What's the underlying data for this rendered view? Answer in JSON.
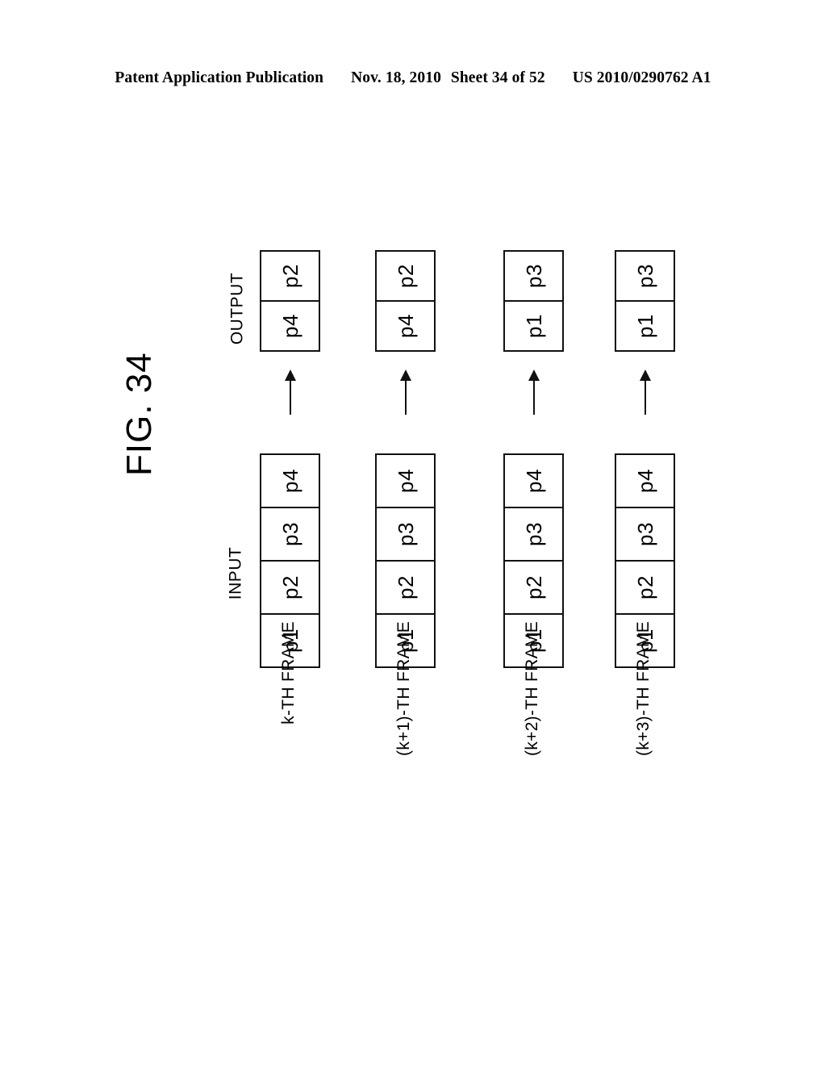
{
  "header": {
    "publication": "Patent Application Publication",
    "date": "Nov. 18, 2010",
    "sheet": "Sheet 34 of 52",
    "patent_number": "US 2010/0290762 A1"
  },
  "figure": {
    "label": "FIG. 34",
    "input_caption": "INPUT",
    "output_caption": "OUTPUT",
    "arrow_icon": "up-arrow-icon",
    "orientation": "rotated-90-ccw",
    "line_color": "#111111",
    "background_color": "#ffffff",
    "rows": [
      {
        "frame_label": "k-TH FRAME",
        "input_cells": [
          "p1",
          "p2",
          "p3",
          "p4"
        ],
        "output_cells": [
          "p2",
          "p4"
        ]
      },
      {
        "frame_label": "(k+1)-TH FRAME",
        "input_cells": [
          "p1",
          "p2",
          "p3",
          "p4"
        ],
        "output_cells": [
          "p2",
          "p4"
        ]
      },
      {
        "frame_label": "(k+2)-TH FRAME",
        "input_cells": [
          "p1",
          "p2",
          "p3",
          "p4"
        ],
        "output_cells": [
          "p1",
          "p3"
        ]
      },
      {
        "frame_label": "(k+3)-TH FRAME",
        "input_cells": [
          "p1",
          "p2",
          "p3",
          "p4"
        ],
        "output_cells": [
          "p1",
          "p3"
        ]
      }
    ]
  },
  "chart_data": {
    "type": "diagram",
    "title": "FIG. 34",
    "description": "Per-frame input to output pixel selection diagram",
    "columns": [
      "INPUT",
      "OUTPUT"
    ],
    "categories": [
      "k-TH FRAME",
      "(k+1)-TH FRAME",
      "(k+2)-TH FRAME",
      "(k+3)-TH FRAME"
    ],
    "series": [
      {
        "name": "INPUT",
        "values": [
          [
            "p1",
            "p2",
            "p3",
            "p4"
          ],
          [
            "p1",
            "p2",
            "p3",
            "p4"
          ],
          [
            "p1",
            "p2",
            "p3",
            "p4"
          ],
          [
            "p1",
            "p2",
            "p3",
            "p4"
          ]
        ]
      },
      {
        "name": "OUTPUT",
        "values": [
          [
            "p2",
            "p4"
          ],
          [
            "p2",
            "p4"
          ],
          [
            "p1",
            "p3"
          ],
          [
            "p1",
            "p3"
          ]
        ]
      }
    ]
  }
}
